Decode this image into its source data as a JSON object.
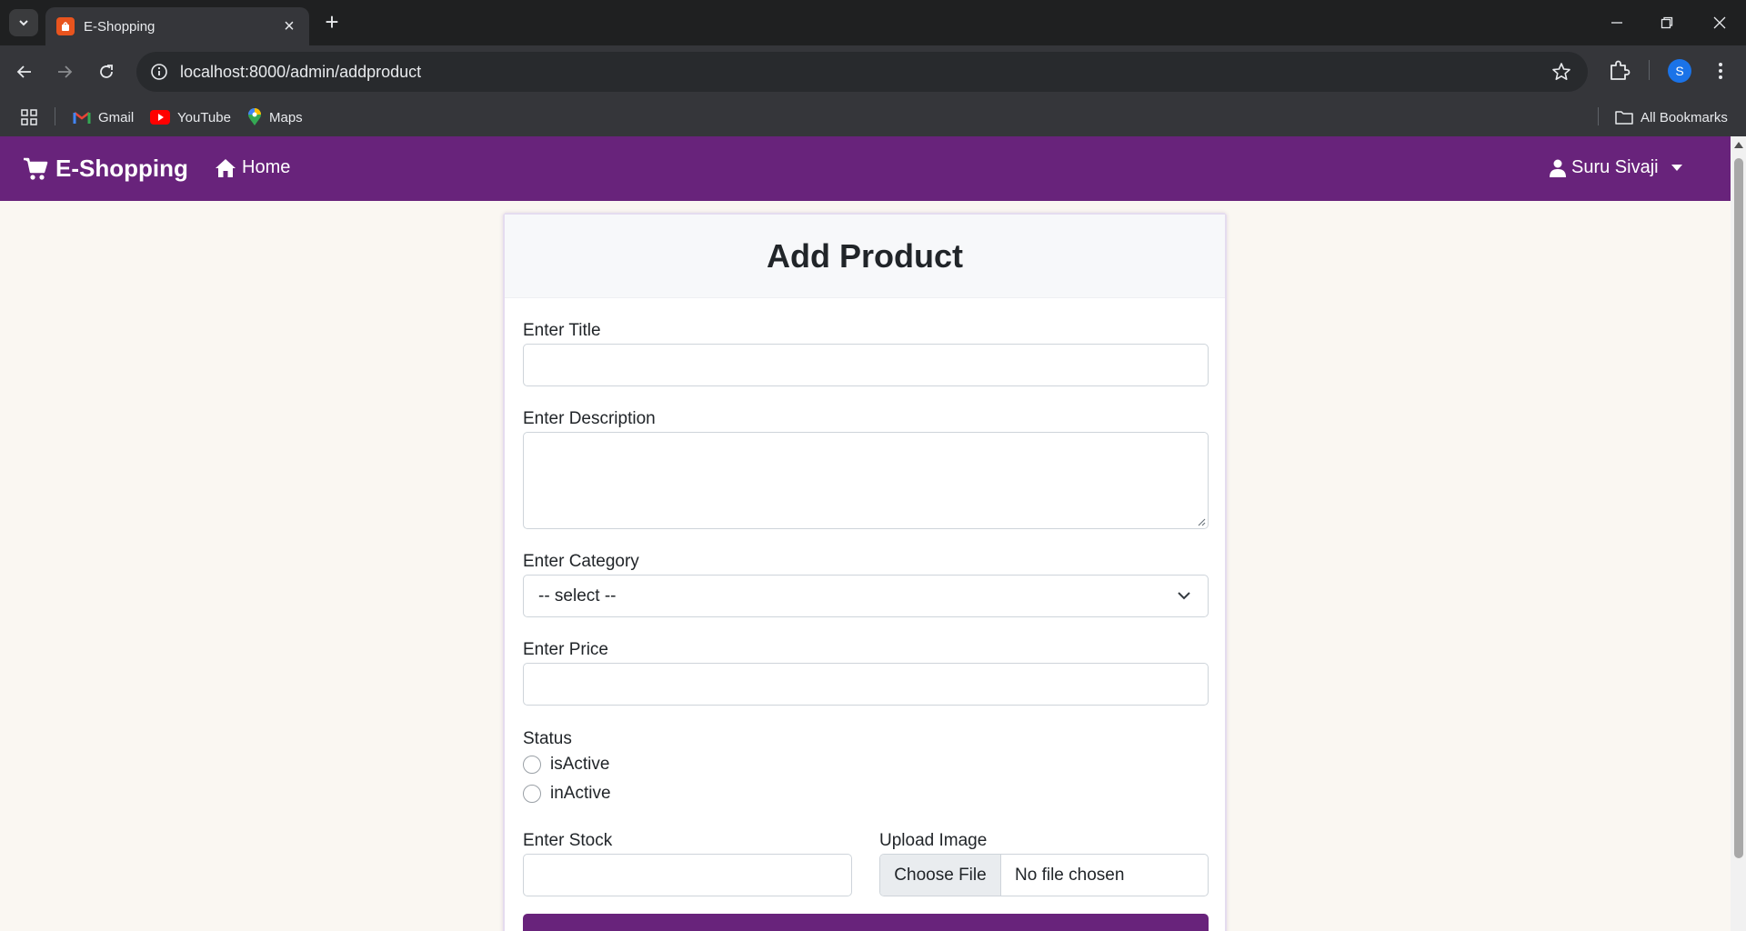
{
  "browser": {
    "tab_title": "E-Shopping",
    "url": "localhost:8000/admin/addproduct",
    "profile_initial": "S",
    "bookmarks": [
      "Gmail",
      "YouTube",
      "Maps"
    ],
    "all_bookmarks": "All Bookmarks"
  },
  "navbar": {
    "brand": "E-Shopping",
    "home": "Home",
    "user": "Suru Sivaji",
    "color": "#68237b"
  },
  "form": {
    "heading": "Add Product",
    "title_label": "Enter Title",
    "title_value": "",
    "description_label": "Enter Description",
    "description_value": "",
    "category_label": "Enter Category",
    "category_selected": "-- select --",
    "price_label": "Enter Price",
    "price_value": "",
    "status_label": "Status",
    "status_options": [
      "isActive",
      "inActive"
    ],
    "stock_label": "Enter Stock",
    "stock_value": "",
    "image_label": "Upload Image",
    "choose_file": "Choose File",
    "no_file": "No file chosen"
  }
}
